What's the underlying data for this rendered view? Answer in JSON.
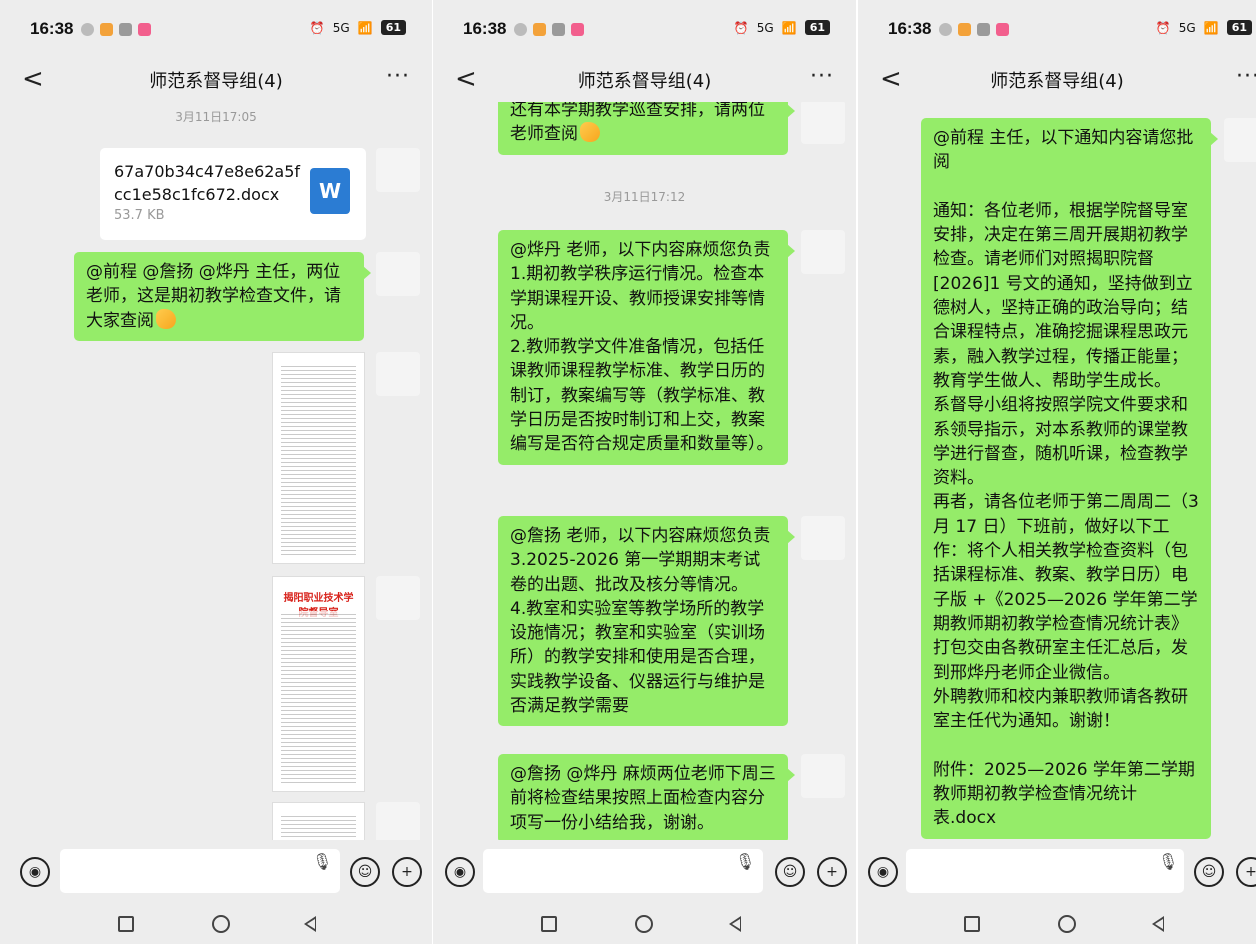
{
  "status": {
    "time": "16:38",
    "battery": "61",
    "network": "5G"
  },
  "header": {
    "title": "师范系督导组(4)",
    "back": "<",
    "more": "···"
  },
  "icons": [
    "back-icon",
    "more-icon",
    "voice-icon",
    "emoji-button-icon",
    "plus-icon",
    "mic-icon",
    "word-file-icon",
    "home-icon",
    "recent-icon",
    "back-nav-icon"
  ],
  "panel1": {
    "timestamp": "3月11日17:05",
    "file": {
      "name": "67a70b34c47e8e62a5fcc1e58c1fc672.docx",
      "size": "53.7 KB",
      "type_letter": "W"
    },
    "message": "@前程 @詹扬 @烨丹 主任，两位老师，这是期初教学检查文件，请大家查阅",
    "thumb_title": "揭阳职业技术学院督导室"
  },
  "panel2": {
    "top_message": "还有本学期教学巡查安排，请两位老师查阅",
    "timestamp": "3月11日17:12",
    "message1": "@烨丹 老师，以下内容麻烦您负责\n1.期初教学秩序运行情况。检查本学期课程开设、教师授课安排等情况。\n2.教师教学文件准备情况，包括任课教师课程教学标准、教学日历的制订，教案编写等（教学标准、教学日历是否按时制订和上交，教案编写是否符合规定质量和数量等）。",
    "message2": "@詹扬 老师，以下内容麻烦您负责\n3.2025-2026 第一学期期末考试卷的出题、批改及核分等情况。\n4.教室和实验室等教学场所的教学设施情况；教室和实验室（实训场所）的教学安排和使用是否合理，实践教学设备、仪器运行与维护是否满足教学需要",
    "message3": "@詹扬 @烨丹 麻烦两位老师下周三前将检查结果按照上面检查内容分项写一份小结给我，谢谢。"
  },
  "panel3": {
    "message": "@前程 主任，以下通知内容请您批阅\n\n通知：各位老师，根据学院督导室安排，决定在第三周开展期初教学检查。请老师们对照揭职院督[2026]1 号文的通知，坚持做到立德树人，坚持正确的政治导向；结合课程特点，准确挖掘课程思政元素，融入教学过程，传播正能量；教育学生做人、帮助学生成长。\n系督导小组将按照学院文件要求和系领导指示，对本系教师的课堂教学进行督查，随机听课，检查教学资料。\n再者，请各位老师于第二周周二（3 月 17 日）下班前，做好以下工作：将个人相关教学检查资料（包括课程标准、教案、教学日历）电子版 +《2025—2026 学年第二学期教师期初教学检查情况统计表》打包交由各教研室主任汇总后，发到邢烨丹老师企业微信。\n外聘教师和校内兼职教师请各教研室主任代为通知。谢谢！\n\n附件：2025—2026 学年第二学期教师期初教学检查情况统计表.docx"
  }
}
